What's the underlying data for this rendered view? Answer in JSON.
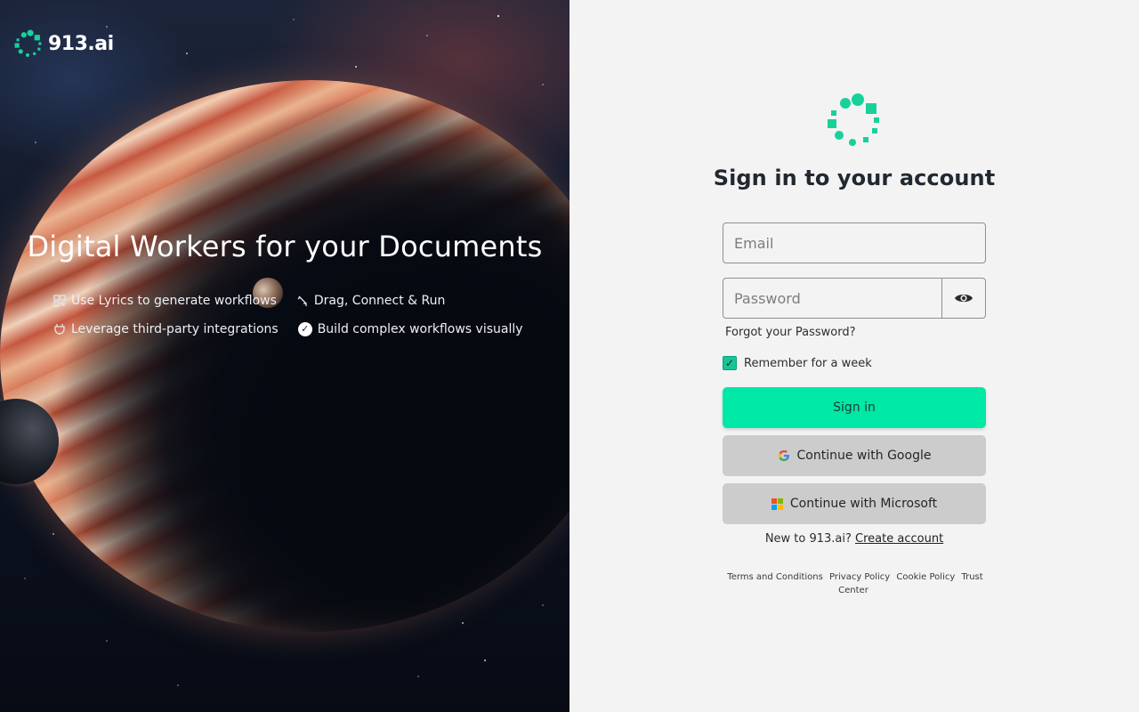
{
  "brand": {
    "name": "913.ai",
    "accent": "#17d19b"
  },
  "hero": {
    "title": "Digital Workers for your Documents",
    "features": [
      {
        "icon": "grid-icon",
        "label": "Use Lyrics to generate workflows"
      },
      {
        "icon": "plug-cursor-icon",
        "label": "Drag, Connect & Run"
      },
      {
        "icon": "plug-icon",
        "label": "Leverage third-party integrations"
      },
      {
        "icon": "check-circle-icon",
        "label": "Build complex workflows visually"
      }
    ]
  },
  "form": {
    "title": "Sign in to your account",
    "email_placeholder": "Email",
    "password_placeholder": "Password",
    "forgot_label": "Forgot your Password?",
    "remember_label": "Remember for a week",
    "remember_checked": true,
    "signin_label": "Sign in",
    "google_label": "Continue with Google",
    "microsoft_label": "Continue with Microsoft",
    "new_prefix": "New to 913.ai?",
    "create_label": "Create account",
    "signin_color": "#00e8a6"
  },
  "footer": {
    "terms": "Terms and Conditions",
    "privacy": "Privacy Policy",
    "cookie": "Cookie Policy",
    "trust": "Trust Center"
  }
}
